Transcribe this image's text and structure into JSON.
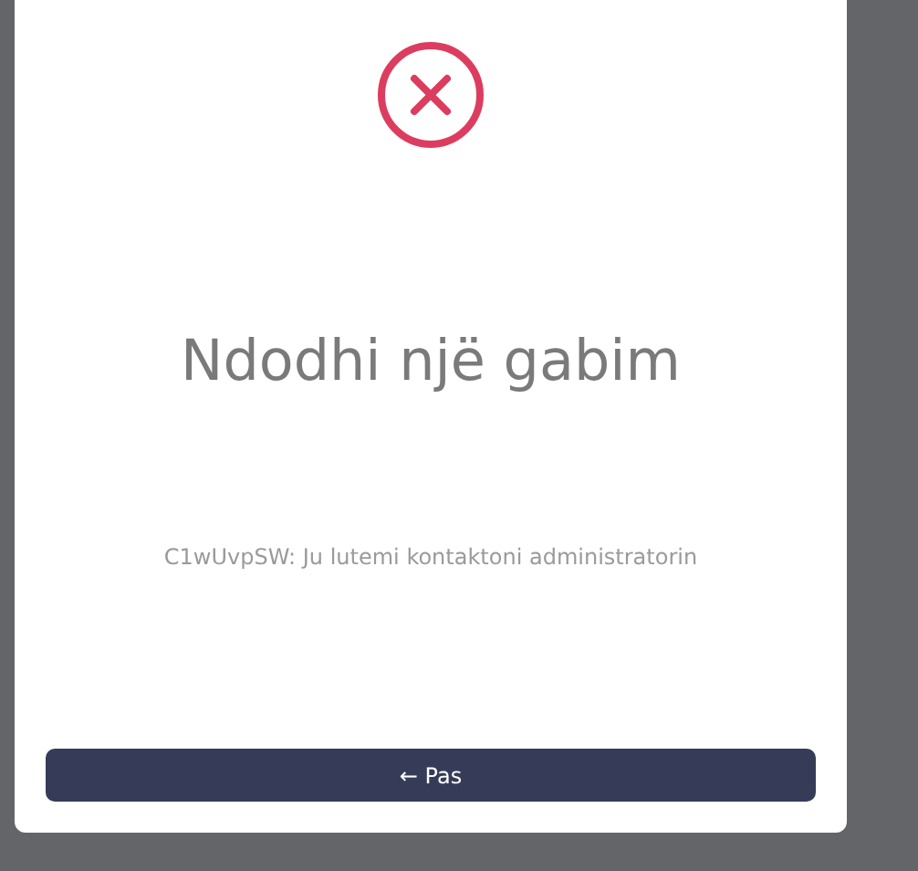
{
  "dialog": {
    "title": "Ndodhi një gabim",
    "message": "C1wUvpSW: Ju lutemi kontaktoni administratorin",
    "button": "← Pas"
  }
}
